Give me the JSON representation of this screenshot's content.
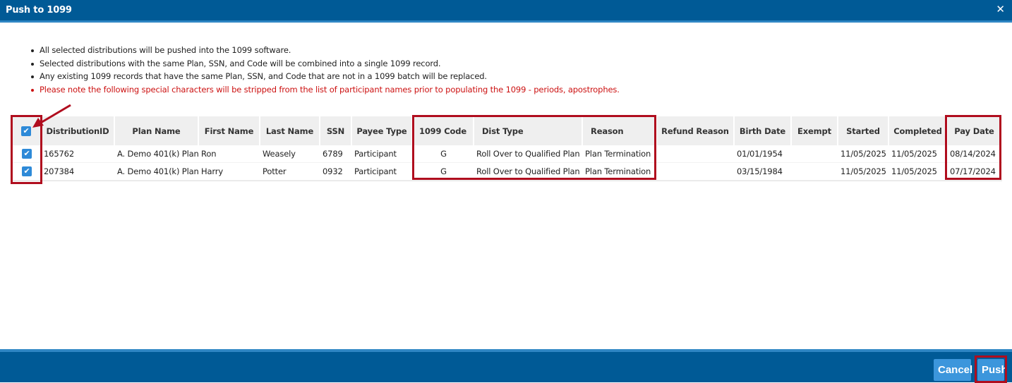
{
  "dialog": {
    "title": "Push to 1099",
    "close_glyph": "✕"
  },
  "notes": [
    "All selected distributions will be pushed into the 1099 software.",
    "Selected distributions with the same Plan, SSN, and Code will be combined into a single 1099 record.",
    "Any existing 1099 records that have the same Plan, SSN, and Code that are not in a 1099 batch will be replaced.",
    "Please note the following special characters will be stripped from the list of participant names prior to populating the 1099 - periods, apostrophes."
  ],
  "table": {
    "columns": [
      "DistributionID",
      "Plan Name",
      "First Name",
      "Last Name",
      "SSN",
      "Payee Type",
      "1099 Code",
      "Dist Type",
      "Reason",
      "Refund Reason",
      "Birth Date",
      "Exempt",
      "Started",
      "Completed",
      "Pay Date"
    ],
    "select_all_checked": true,
    "rows": [
      {
        "checked": true,
        "distribution_id": "165762",
        "plan_name": "A. Demo 401(k) Plan",
        "first_name": "Ron",
        "last_name": "Weasely",
        "ssn": "6789",
        "payee_type": "Participant",
        "code_1099": "G",
        "dist_type": "Roll Over to Qualified Plan",
        "reason": "Plan Termination",
        "refund_reason": "",
        "birth_date": "01/01/1954",
        "exempt": "",
        "started": "11/05/2025",
        "completed": "11/05/2025",
        "pay_date": "08/14/2024"
      },
      {
        "checked": true,
        "distribution_id": "207384",
        "plan_name": "A. Demo 401(k) Plan",
        "first_name": "Harry",
        "last_name": "Potter",
        "ssn": "0932",
        "payee_type": "Participant",
        "code_1099": "G",
        "dist_type": "Roll Over to Qualified Plan",
        "reason": "Plan Termination",
        "refund_reason": "",
        "birth_date": "03/15/1984",
        "exempt": "",
        "started": "11/05/2025",
        "completed": "11/05/2025",
        "pay_date": "07/17/2024"
      }
    ]
  },
  "footer": {
    "cancel_label": "Cancel",
    "push_label": "Push"
  },
  "colors": {
    "header_blue": "#005a96",
    "button_blue": "#3c96dc",
    "warning_red": "#cc1111",
    "annotation_red": "#b00d1e"
  }
}
